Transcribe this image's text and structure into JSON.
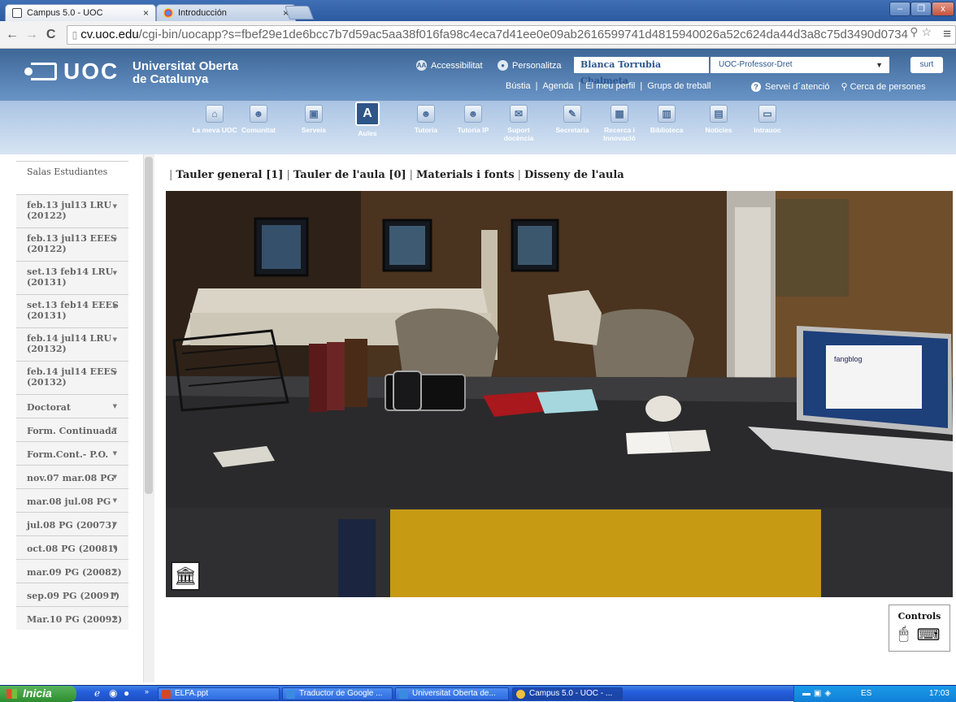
{
  "browser": {
    "tabs": [
      {
        "title": "Campus 5.0 - UOC",
        "active": true
      },
      {
        "title": "Introducción",
        "active": false
      }
    ],
    "url_domain": "cv.uoc.edu",
    "url_path": "/cgi-bin/uocapp?s=fbef29e1de6bcc7b7d59ac5aa38f016fa98c4eca7d41ee0e09ab2616599741d4815940026a52c624da44d3a8c75d3490d0734",
    "window_buttons": [
      "–",
      "❐",
      "x"
    ]
  },
  "header": {
    "logo": "UOC",
    "university_line1": "Universitat Oberta",
    "university_line2": "de Catalunya",
    "accessibilitat": "Accessibilitat",
    "personalitza": "Personalitza",
    "username": "Blanca Torrubia Chalmeta",
    "profile": "UOC-Professor-Dret",
    "logout": "surt",
    "links": [
      "Bústia",
      "Agenda",
      "El meu perfil",
      "Grups de treball"
    ],
    "servei": "Servei d´atenció",
    "cerca": "Cerca de persones"
  },
  "menu": [
    {
      "label": "La meva UOC",
      "icon": "⌂"
    },
    {
      "label": "Comunitat",
      "icon": "☻"
    },
    {
      "label": "Serveis",
      "icon": "▣"
    },
    {
      "label": "Aules",
      "icon": "A",
      "active": true
    },
    {
      "label": "Tutoria",
      "icon": "☻"
    },
    {
      "label": "Tutoria IP",
      "icon": "☻"
    },
    {
      "label": "Suport docència",
      "icon": "✉"
    },
    {
      "label": "Secretaria",
      "icon": "✎"
    },
    {
      "label": "Recerca i Innovació",
      "icon": "▦"
    },
    {
      "label": "Biblioteca",
      "icon": "▥"
    },
    {
      "label": "Notícies",
      "icon": "▤"
    },
    {
      "label": "Intrauoc",
      "icon": "▭"
    }
  ],
  "sidebar": [
    {
      "label": "Salas Estudiantes",
      "dropdown": false
    },
    {
      "label": "feb.13 jul13 LRU (20122)",
      "dropdown": true
    },
    {
      "label": "feb.13 jul13 EEES (20122)",
      "dropdown": true
    },
    {
      "label": "set.13 feb14 LRU (20131)",
      "dropdown": true
    },
    {
      "label": "set.13 feb14 EEES (20131)",
      "dropdown": true
    },
    {
      "label": "feb.14 jul14 LRU (20132)",
      "dropdown": true
    },
    {
      "label": "feb.14 jul14 EEES (20132)",
      "dropdown": true
    },
    {
      "label": "Doctorat",
      "dropdown": true
    },
    {
      "label": "Form. Continuada",
      "dropdown": true
    },
    {
      "label": "Form.Cont.- P.O.",
      "dropdown": true
    },
    {
      "label": "nov.07 mar.08 PG",
      "dropdown": true
    },
    {
      "label": "mar.08 jul.08 PG",
      "dropdown": true
    },
    {
      "label": "jul.08 PG (20073)",
      "dropdown": true
    },
    {
      "label": "oct.08 PG (20081)",
      "dropdown": true
    },
    {
      "label": "mar.09 PG (20082)",
      "dropdown": true
    },
    {
      "label": "sep.09 PG (20091)",
      "dropdown": true
    },
    {
      "label": "Mar.10 PG (20092)",
      "dropdown": true
    }
  ],
  "aule_tabs": [
    "Tauler general [1]",
    "Tauler de l'aula [0]",
    "Materials i fonts",
    "Disseny de l'aula"
  ],
  "controls": {
    "title": "Controls"
  },
  "scene": {
    "laptop_text": "fangblog",
    "museum_icon": "museum-icon"
  },
  "taskbar": {
    "start": "Inicia",
    "tasks": [
      "ELFA.ppt",
      "Traductor de Google ...",
      "Universitat Oberta de...",
      "Campus 5.0 - UOC - ..."
    ],
    "lang": "ES",
    "time": "17:03"
  }
}
